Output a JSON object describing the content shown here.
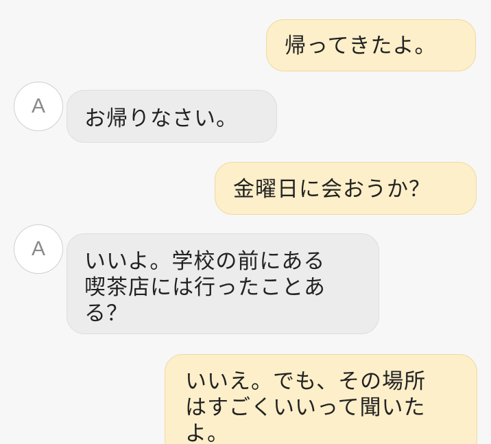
{
  "conversation": {
    "messages": [
      {
        "sender": "me",
        "text": "帰ってきたよ。"
      },
      {
        "sender": "A",
        "avatar_letter": "A",
        "text": "お帰りなさい。"
      },
      {
        "sender": "me",
        "text": "金曜日に会おうか？"
      },
      {
        "sender": "A",
        "avatar_letter": "A",
        "text": "いいよ。学校の前にある\n喫茶店には行ったことあ\nる？"
      },
      {
        "sender": "me",
        "text": "いいえ。でも、その場所\nはすごくいいって聞いた\nよ。"
      }
    ]
  },
  "colors": {
    "background": "#f7f7f7",
    "sent_bubble": "#fdefc9",
    "received_bubble": "#ececec",
    "avatar_letter": "#8a8a8a"
  }
}
